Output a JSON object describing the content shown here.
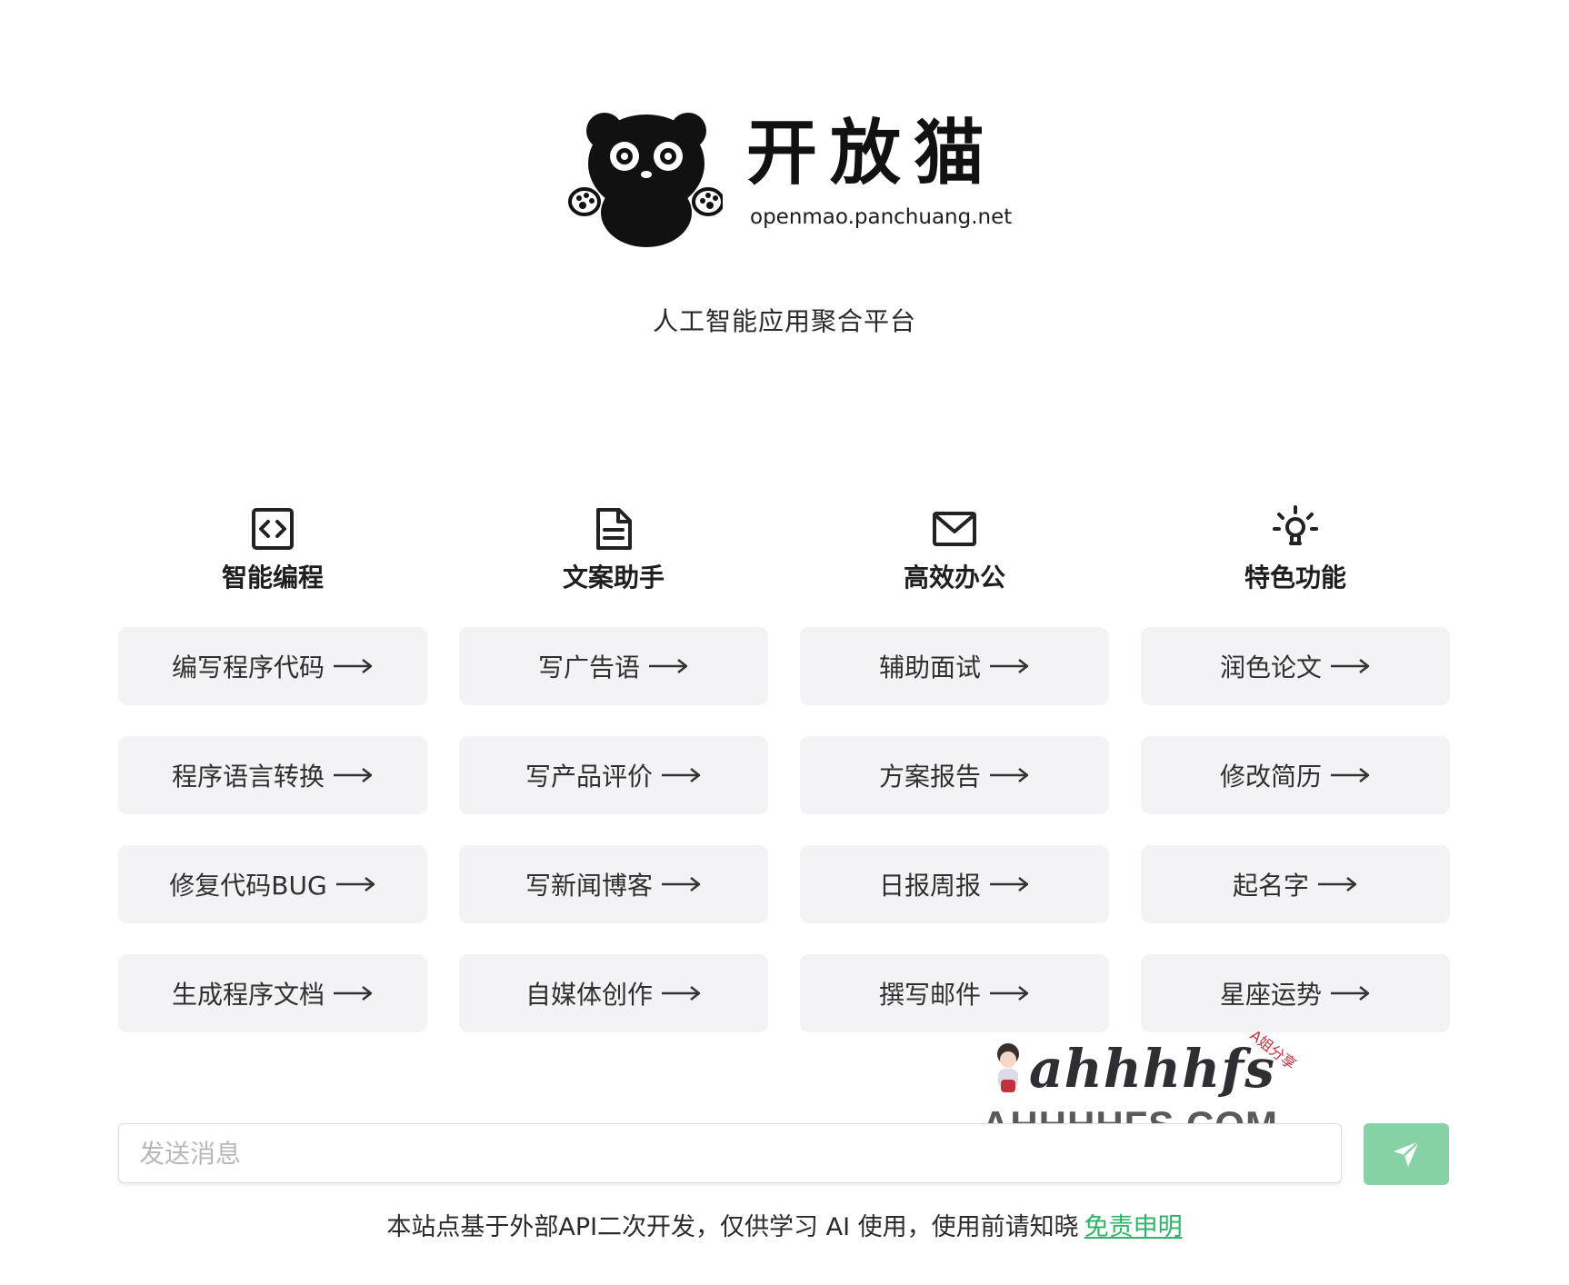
{
  "brand": {
    "name": "开放猫",
    "domain": "openmao.panchuang.net",
    "tagline": "人工智能应用聚合平台"
  },
  "columns": [
    {
      "title": "智能编程",
      "icon": "code-icon",
      "items": [
        "编写程序代码",
        "程序语言转换",
        "修复代码BUG",
        "生成程序文档"
      ]
    },
    {
      "title": "文案助手",
      "icon": "document-icon",
      "items": [
        "写广告语",
        "写产品评价",
        "写新闻博客",
        "自媒体创作"
      ]
    },
    {
      "title": "高效办公",
      "icon": "mail-icon",
      "items": [
        "辅助面试",
        "方案报告",
        "日报周报",
        "撰写邮件"
      ]
    },
    {
      "title": "特色功能",
      "icon": "lightbulb-icon",
      "items": [
        "润色论文",
        "修改简历",
        "起名字",
        "星座运势"
      ]
    }
  ],
  "input": {
    "placeholder": "发送消息",
    "value": ""
  },
  "send_button": {
    "icon": "send-icon",
    "color": "#86d1a6"
  },
  "footer": {
    "text": "本站点基于外部API二次开发，仅供学习 AI 使用，使用前请知晓",
    "link_label": "免责申明",
    "link_color": "#2fb36a"
  },
  "watermark": {
    "script_text": "ahhhhfs",
    "small_text": "A姐分享",
    "domain": "AHHHHFS.COM"
  }
}
